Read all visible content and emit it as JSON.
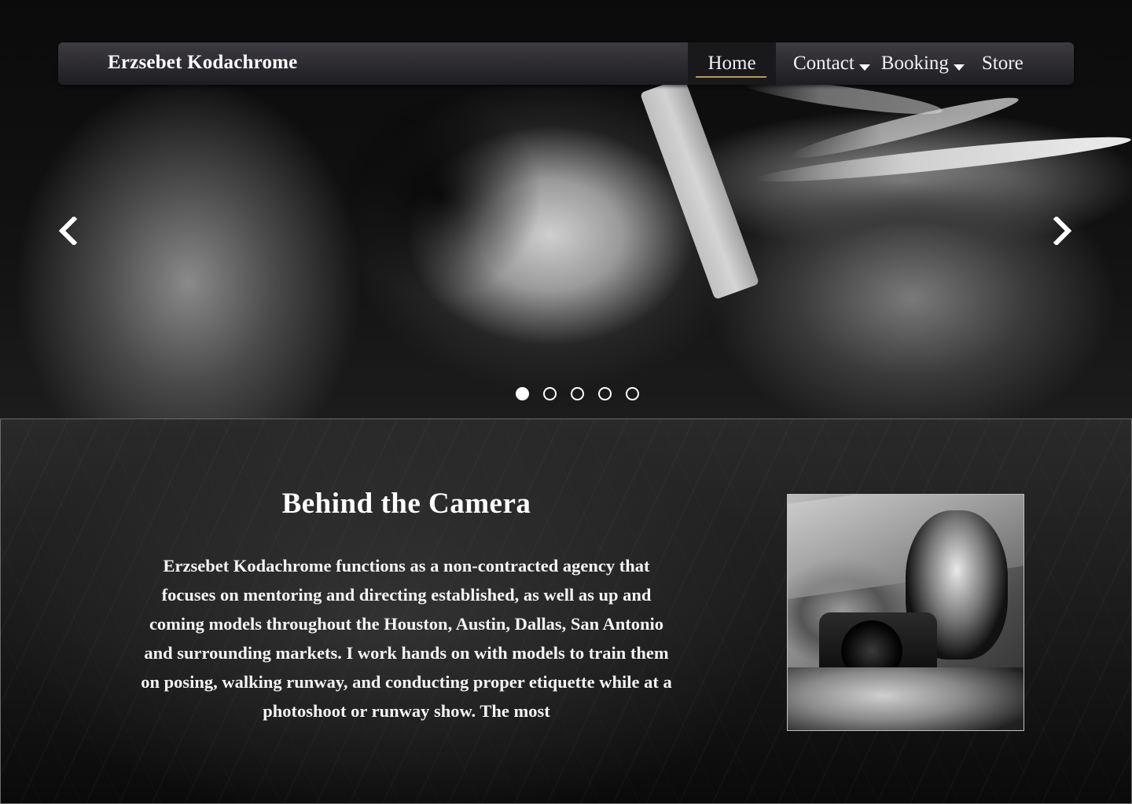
{
  "nav": {
    "brand": "Erzsebet Kodachrome",
    "items": [
      {
        "label": "Home",
        "active": true,
        "dropdown": false
      },
      {
        "label": "Contact",
        "active": false,
        "dropdown": true
      },
      {
        "label": "Booking",
        "active": false,
        "dropdown": true
      },
      {
        "label": "Store",
        "active": false,
        "dropdown": false
      }
    ]
  },
  "carousel": {
    "prev_icon": "chevron-left-icon",
    "next_icon": "chevron-right-icon",
    "slide_count": 5,
    "active_slide": 1
  },
  "about": {
    "title": "Behind the Camera",
    "text": "Erzsebet Kodachrome functions as a non-contracted agency that focuses on mentoring and directing established, as well as up and coming models throughout the Houston, Austin, Dallas, San Antonio and surrounding markets. I work hands on with models to train them on posing, walking runway, and conducting proper etiquette while at a photoshoot or runway show. The most"
  },
  "colors": {
    "nav_background": "#2c2b2f",
    "active_underline": "#b59a5a",
    "text": "#ffffff"
  }
}
